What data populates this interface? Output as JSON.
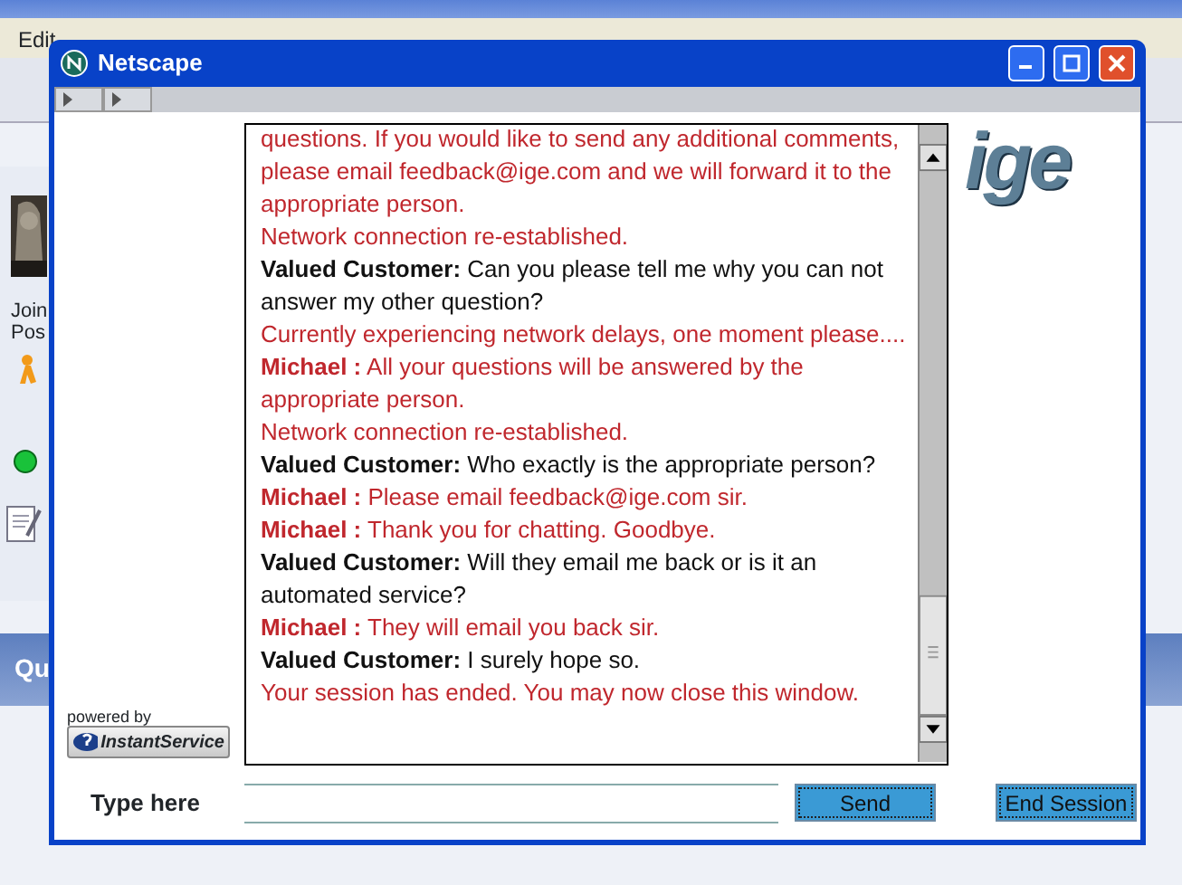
{
  "background_window": {
    "menu": [
      "Edit"
    ],
    "side_texts": [
      "Join",
      "Pos"
    ],
    "panel_title": "Qu"
  },
  "window": {
    "title": "Netscape"
  },
  "chat": {
    "messages": [
      {
        "kind": "agent",
        "text": "questions. If you would like to send any additional comments, please email feedback@ige.com and we will forward it to the appropriate person."
      },
      {
        "kind": "system",
        "text": "Network connection re-established."
      },
      {
        "kind": "customer",
        "sender": "Valued Customer:",
        "text": "Can you please tell me why you can not answer my other question?"
      },
      {
        "kind": "system",
        "text": "Currently experiencing network delays, one moment please...."
      },
      {
        "kind": "agent",
        "sender": "Michael :",
        "text": "All your questions will be answered by the appropriate person."
      },
      {
        "kind": "system",
        "text": "Network connection re-established."
      },
      {
        "kind": "customer",
        "sender": "Valued Customer:",
        "text": "Who exactly is the appropriate person?"
      },
      {
        "kind": "agent",
        "sender": "Michael :",
        "text": "Please email feedback@ige.com sir."
      },
      {
        "kind": "agent",
        "sender": "Michael :",
        "text": "Thank you for chatting. Goodbye."
      },
      {
        "kind": "customer",
        "sender": "Valued Customer:",
        "text": "Will they email me back or is it an automated service?"
      },
      {
        "kind": "agent",
        "sender": "Michael :",
        "text": "They will email you back sir."
      },
      {
        "kind": "customer",
        "sender": "Valued Customer:",
        "text": "I surely hope so."
      },
      {
        "kind": "system",
        "text": "Your session has ended. You may now close this window."
      }
    ]
  },
  "logo": "ige",
  "powered_by": {
    "label": "powered by",
    "brand": "InstantService"
  },
  "input": {
    "label": "Type here"
  },
  "buttons": [
    {
      "label": "Send"
    },
    {
      "label": "End Session"
    }
  ]
}
